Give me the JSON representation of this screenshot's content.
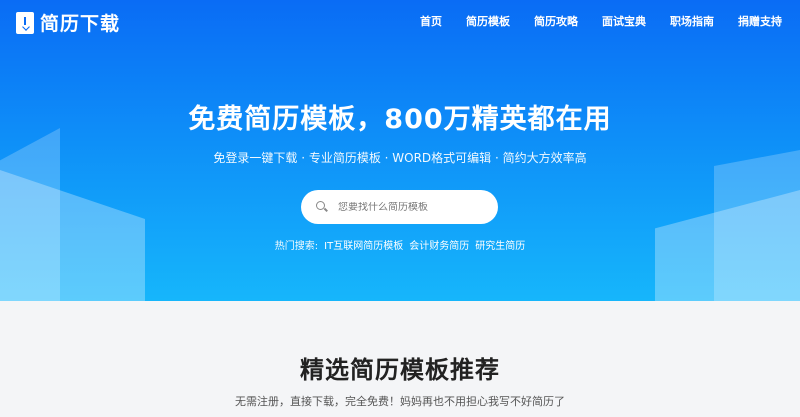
{
  "brand": {
    "logo_icon": "download-document-icon",
    "name": "简历下载"
  },
  "nav": [
    {
      "label": "首页"
    },
    {
      "label": "简历模板"
    },
    {
      "label": "简历攻略"
    },
    {
      "label": "面试宝典"
    },
    {
      "label": "职场指南"
    },
    {
      "label": "捐赠支持"
    }
  ],
  "hero": {
    "headline": "免费简历模板，800万精英都在用",
    "subline": "免登录一键下载 · 专业简历模板 · WORD格式可编辑 · 简约大方效率高",
    "search": {
      "icon": "search-icon",
      "placeholder": "您要找什么简历模板"
    },
    "hot": {
      "label": "热门搜索:",
      "links": [
        "IT互联网简历模板",
        "会计财务简历",
        "研究生简历"
      ]
    }
  },
  "section": {
    "title": "精选简历模板推荐",
    "subtitle": "无需注册，直接下载，完全免费！妈妈再也不用担心我写不好简历了"
  },
  "colors": {
    "hero_top": "#0a6cf5",
    "hero_bottom": "#16b6fb",
    "page_bg": "#f4f5f7"
  }
}
